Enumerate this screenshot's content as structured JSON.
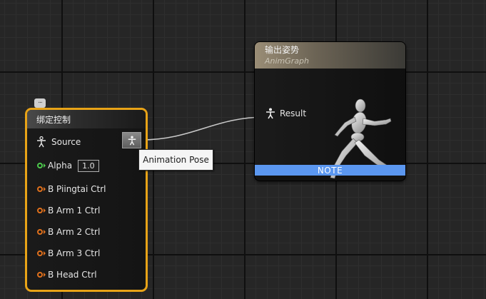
{
  "blend_node": {
    "title": "绑定控制",
    "source_label": "Source",
    "alpha_label": "Alpha",
    "alpha_value": "1.0",
    "pins": [
      "B Piingtai Ctrl",
      "B Arm 1 Ctrl",
      "B Arm 2 Ctrl",
      "B Arm 3 Ctrl",
      "B Head Ctrl"
    ],
    "border_color": "#e8a317"
  },
  "tooltip": {
    "text": "Animation Pose"
  },
  "result_node": {
    "title": "输出姿势",
    "subtitle": "AnimGraph",
    "result_label": "Result",
    "note_label": "NOTE",
    "note_color": "#5b97f0"
  },
  "icons": {
    "comment": "comment-bubble-icon",
    "pose_pin": "pose-person-icon",
    "preview": "mannequin-running-icon"
  }
}
